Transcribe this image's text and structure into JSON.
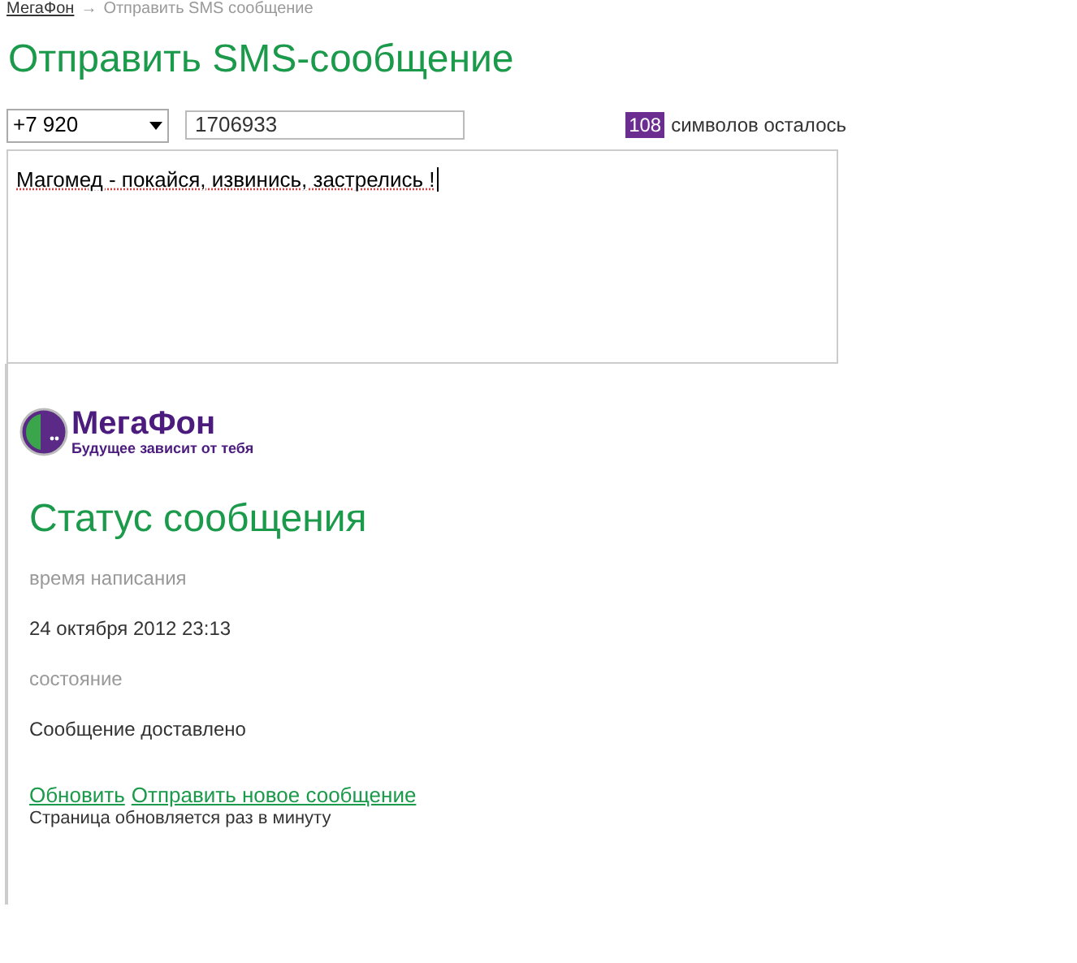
{
  "breadcrumb": {
    "home": "МегаФон",
    "arrow": "→",
    "current": "Отправить SMS сообщение"
  },
  "title": "Отправить SMS-сообщение",
  "form": {
    "prefix": "+7 920",
    "number": "1706933",
    "counter": "108",
    "counter_label": "символов осталось",
    "message": "Магомед - покайся, извинись, застрелись !"
  },
  "status_page": {
    "logo": {
      "name": "МегаФон",
      "tagline": "Будущее зависит от тебя"
    },
    "title": "Статус сообщения",
    "fields": [
      {
        "label": "время написания",
        "value": "24 октября 2012 23:13"
      },
      {
        "label": "состояние",
        "value": "Сообщение доставлено"
      }
    ],
    "links": [
      "Обновить",
      "Отправить новое сообщение"
    ],
    "note": "Страница обновляется раз в минуту"
  }
}
